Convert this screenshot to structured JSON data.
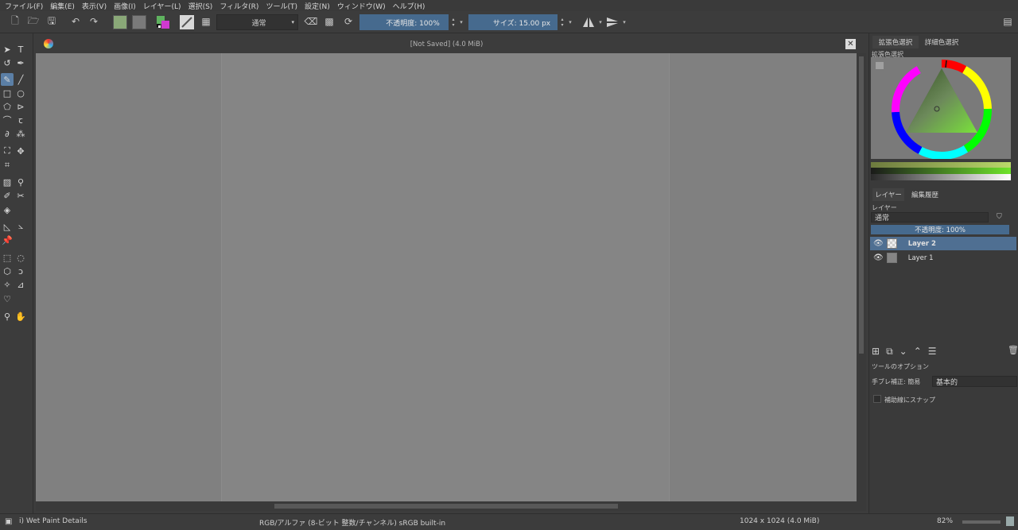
{
  "menu": [
    "ファイル(F)",
    "編集(E)",
    "表示(V)",
    "画像(I)",
    "レイヤー(L)",
    "選択(S)",
    "フィルタ(R)",
    "ツール(T)",
    "設定(N)",
    "ウィンドウ(W)",
    "ヘルプ(H)"
  ],
  "toolbar": {
    "blend_mode": "通常",
    "opacity_label": "不透明度: 100%",
    "size_label": "サイズ: 15.00 px",
    "fg_color": "#8aa878",
    "bg_color": "#7a7a7a"
  },
  "canvas": {
    "title": "[Not Saved]  (4.0 MiB)",
    "background": "#808080",
    "doc_color": "#858585"
  },
  "dock": {
    "tabs_top": [
      "拡張色選択",
      "詳細色選択"
    ],
    "color_panel_label": "拡張色選択",
    "tabs_layers": [
      "レイヤー",
      "編集履歴"
    ],
    "layers_label": "レイヤー",
    "layer_blend": "通常",
    "layer_opacity": "不透明度: 100%",
    "layers": [
      {
        "name": "Layer 2",
        "selected": true
      },
      {
        "name": "Layer 1",
        "selected": false
      }
    ],
    "tool_options_label": "ツールのオプション",
    "stabilizer_label": "手ブレ補正: 簡易",
    "stabilizer_value": "基本的",
    "snap_label": "補助線にスナップ"
  },
  "status": {
    "brush": "i) Wet Paint Details",
    "color_space": "RGB/アルファ (8-ビット 整数/チャンネル)  sRGB built-in",
    "dimensions": "1024 x 1024 (4.0 MiB)",
    "zoom": "82%"
  }
}
